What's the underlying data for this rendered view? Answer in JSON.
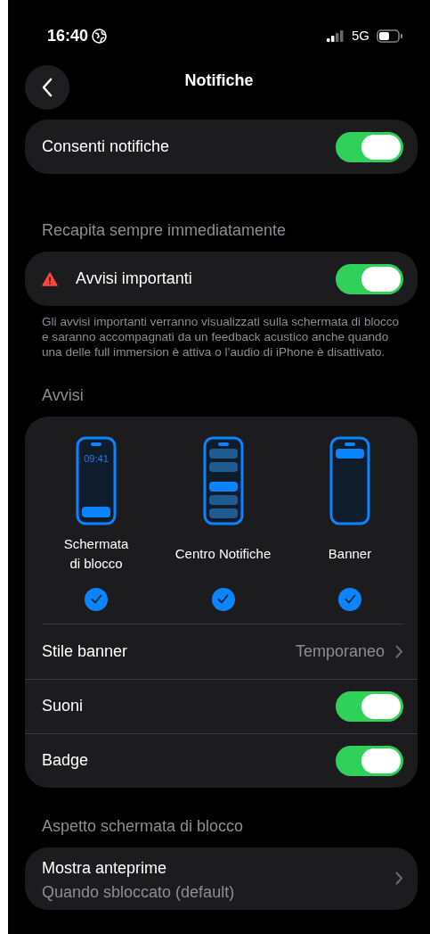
{
  "status_bar": {
    "time": "16:40",
    "network": "5G"
  },
  "nav": {
    "title": "Notifiche"
  },
  "sections": [
    {
      "rows": [
        {
          "kind": "toggle",
          "label": "Consenti notifiche",
          "on": true
        }
      ]
    },
    {
      "header": "Recapita sempre immediatamente",
      "rows": [
        {
          "kind": "warning_toggle",
          "label": "Avvisi importanti",
          "on": true
        }
      ],
      "footer": "Gli avvisi importanti verranno visualizzati sulla schermata di blocco e saranno accompagnati da un feedback acustico anche quando una delle full immersion è attiva o l’audio di iPhone è disattivato."
    },
    {
      "header": "Avvisi",
      "styles": [
        {
          "kind": "lock",
          "clock": "09:41",
          "label": "Schermata\ndi blocco",
          "selected": true
        },
        {
          "kind": "center",
          "label": "Centro Notifiche",
          "selected": true
        },
        {
          "kind": "banner",
          "label": "Banner",
          "selected": true
        }
      ],
      "rows": [
        {
          "kind": "link",
          "label": "Stile banner",
          "value": "Temporaneo"
        },
        {
          "kind": "toggle",
          "label": "Suoni",
          "on": true
        },
        {
          "kind": "toggle",
          "label": "Badge",
          "on": true
        }
      ]
    },
    {
      "header": "Aspetto schermata di blocco",
      "rows": [
        {
          "kind": "subtitle_link",
          "label": "Mostra anteprime",
          "value": "Quando sbloccato (default)"
        }
      ]
    }
  ]
}
